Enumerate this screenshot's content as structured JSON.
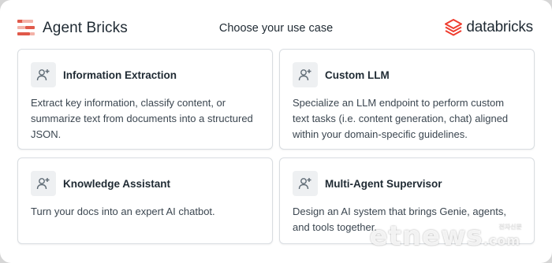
{
  "header": {
    "brand_name": "Agent Bricks",
    "title": "Choose your use case",
    "partner_logo": "databricks"
  },
  "cards": [
    {
      "title": "Information Extraction",
      "description": "Extract key information, classify content, or summarize text from documents into a structured JSON.",
      "icon": "user-plus-icon"
    },
    {
      "title": "Custom LLM",
      "description": "Specialize an LLM endpoint to perform custom text tasks (i.e. content generation, chat) aligned within your domain-specific guidelines.",
      "icon": "user-plus-icon"
    },
    {
      "title": "Knowledge Assistant",
      "description": "Turn your docs into an expert AI chatbot.",
      "icon": "user-plus-icon"
    },
    {
      "title": "Multi-Agent Supervisor",
      "description": "Design an AI system that brings Genie, agents, and tools together.",
      "icon": "user-plus-icon"
    }
  ],
  "watermark": {
    "text": "etnews",
    "small": "전자신문",
    "suffix": ".com"
  },
  "colors": {
    "brand_accent": "#e0594a",
    "databricks_red": "#ef3d2f",
    "card_border": "#d9dde1",
    "icon_bg": "#eef0f2"
  }
}
